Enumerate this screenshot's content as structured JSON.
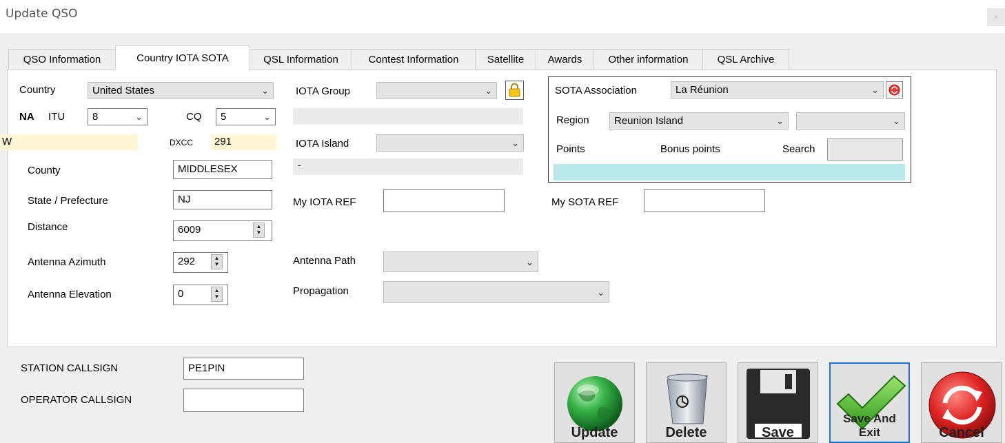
{
  "window": {
    "title": "Update QSO",
    "close_glyph": "×"
  },
  "tabs": [
    {
      "label": "QSO Information"
    },
    {
      "label": "Country IOTA SOTA"
    },
    {
      "label": "QSL Information"
    },
    {
      "label": "Contest Information"
    },
    {
      "label": "Satellite"
    },
    {
      "label": "Awards"
    },
    {
      "label": "Other information"
    },
    {
      "label": "QSL Archive"
    }
  ],
  "country": {
    "label": "Country",
    "value": "United States",
    "continent": "NA",
    "itu_label": "ITU",
    "itu_value": "8",
    "cq_label": "CQ",
    "cq_value": "5",
    "prefix": "W",
    "dxcc_label": "DXCC",
    "dxcc_value": "291",
    "county_label": "County",
    "county_value": "MIDDLESEX",
    "state_label": "State / Prefecture",
    "state_value": "NJ",
    "distance_label": "Distance",
    "distance_value": "6009",
    "azimuth_label": "Antenna Azimuth",
    "azimuth_value": "292",
    "elevation_label": "Antenna Elevation",
    "elevation_value": "0"
  },
  "iota": {
    "group_label": "IOTA Group",
    "group_value": "",
    "island_label": "IOTA Island",
    "island_value": "",
    "island_desc": "-",
    "my_ref_label": "My IOTA REF",
    "my_ref_value": "",
    "antenna_path_label": "Antenna Path",
    "antenna_path_value": "",
    "propagation_label": "Propagation",
    "propagation_value": ""
  },
  "sota": {
    "association_label": "SOTA Association",
    "association_value": "La Réunion",
    "region_label": "Region",
    "region_value": "Reunion Island",
    "region2_value": "",
    "points_label": "Points",
    "bonus_label": "Bonus points",
    "search_label": "Search",
    "search_value": "",
    "my_ref_label": "My SOTA REF",
    "my_ref_value": ""
  },
  "station": {
    "callsign_label": "STATION CALLSIGN",
    "callsign_value": "PE1PIN",
    "operator_label": "OPERATOR CALLSIGN",
    "operator_value": ""
  },
  "buttons": {
    "update": "Update",
    "delete": "Delete",
    "save": "Save",
    "save_exit_line1": "Save And",
    "save_exit_line2": "Exit",
    "cancel": "Cancel"
  },
  "icons": {
    "update": "globe-icon",
    "delete": "recycle-bin-icon",
    "save": "floppy-disk-icon",
    "save_exit": "check-mark-icon",
    "cancel": "refresh-cancel-icon",
    "lock": "padlock-icon",
    "sota_clear": "red-clear-icon"
  },
  "colors": {
    "highlight": "#fff6d6",
    "sota_list": "#b8eaea",
    "focus_border": "#1a73d9"
  }
}
